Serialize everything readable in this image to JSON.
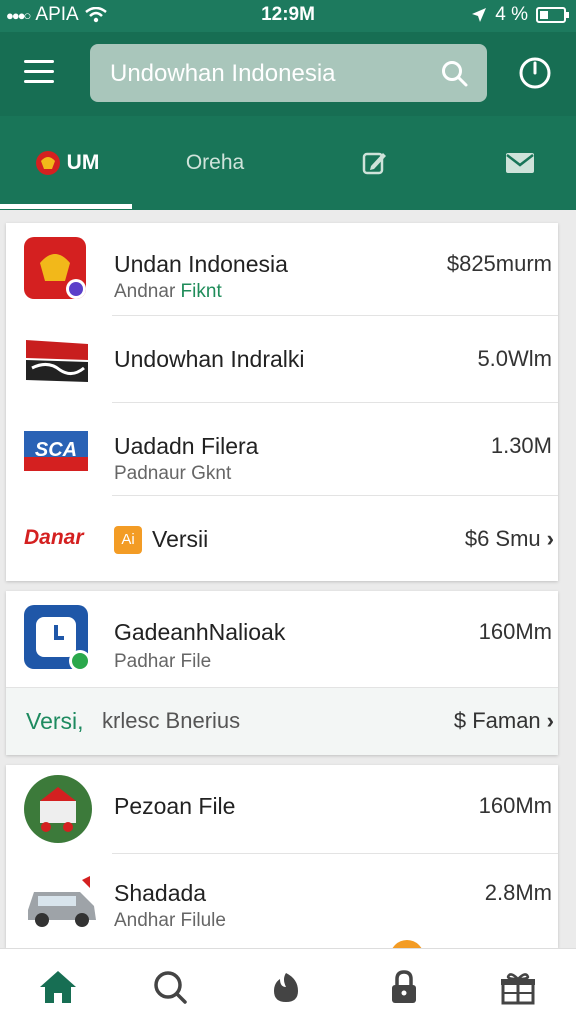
{
  "status_bar": {
    "carrier": "APIA",
    "time": "12:9M",
    "battery": "4 %"
  },
  "app_bar": {
    "search_text": "Undowhan Indonesia"
  },
  "tabs": [
    {
      "label": "UM"
    },
    {
      "label": "Oreha"
    },
    {
      "label": ""
    },
    {
      "label": ""
    }
  ],
  "cards": [
    {
      "rows": [
        {
          "title": "Undan Indonesia",
          "subtitle_a": "Andnar ",
          "subtitle_b": "Fiknt",
          "value": "$825murm"
        },
        {
          "title": "Undowhan Indralki",
          "subtitle_a": "",
          "subtitle_b": "",
          "value": "5.0Wlm"
        },
        {
          "title": "Uadadn Filera",
          "subtitle_a": "Padnaur Gknt",
          "subtitle_b": "",
          "value": "1.30M",
          "logo_text": "SCA"
        },
        {
          "brand": "Danar",
          "badge": "Ai",
          "title": "Versii",
          "value": "$6 Smu"
        }
      ]
    },
    {
      "rows": [
        {
          "title": "GadeanhNalioak",
          "subtitle_a": "Padhar File",
          "value": "160Mm"
        },
        {
          "left": "Versi,",
          "middle": "krlesc Bnerius",
          "value": "$ Faman"
        }
      ]
    },
    {
      "rows": [
        {
          "title": "Pezoan File",
          "value": "160Mm"
        },
        {
          "title": "Shadada",
          "subtitle_a": "Andhar Filule",
          "value": "2.8Mm"
        }
      ]
    }
  ],
  "colors": {
    "primary": "#176e53",
    "accent_green": "#1d8a5f",
    "orange": "#f39c25",
    "red": "#d42020"
  },
  "bottom_nav": [
    "home-icon",
    "search-icon",
    "flame-icon",
    "lock-icon",
    "gift-icon"
  ]
}
